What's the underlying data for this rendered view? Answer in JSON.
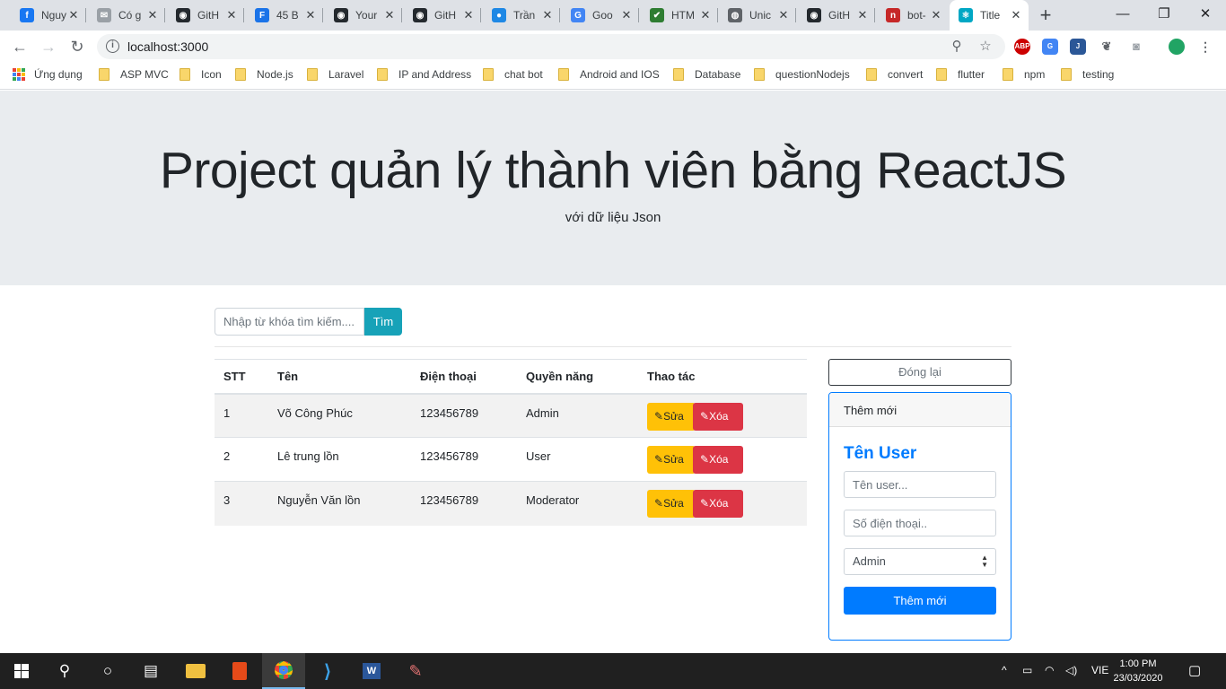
{
  "browser": {
    "tabs": [
      {
        "title": "Nguy",
        "icon": "facebook-icon",
        "color": "#1877f2",
        "glyph": "f"
      },
      {
        "title": "Có g",
        "icon": "mail-icon",
        "color": "#9aa0a6",
        "glyph": "✉"
      },
      {
        "title": "GitH",
        "icon": "github-icon",
        "color": "#24292e",
        "glyph": "◉"
      },
      {
        "title": "45 B",
        "icon": "feather-icon",
        "color": "#1a73e8",
        "glyph": "F"
      },
      {
        "title": "Your",
        "icon": "github-icon",
        "color": "#24292e",
        "glyph": "◉"
      },
      {
        "title": "GitH",
        "icon": "github-icon",
        "color": "#24292e",
        "glyph": "◉"
      },
      {
        "title": "Trần",
        "icon": "avatar-icon",
        "color": "#1e88e5",
        "glyph": "●"
      },
      {
        "title": "Goo",
        "icon": "google-translate-icon",
        "color": "#4285f4",
        "glyph": "G"
      },
      {
        "title": "HTM",
        "icon": "check-icon",
        "color": "#2e7d32",
        "glyph": "✔"
      },
      {
        "title": "Unic",
        "icon": "globe-icon",
        "color": "#5f6368",
        "glyph": "◍"
      },
      {
        "title": "GitH",
        "icon": "github-icon",
        "color": "#24292e",
        "glyph": "◉"
      },
      {
        "title": "bot-",
        "icon": "bot-icon",
        "color": "#c62828",
        "glyph": "n"
      },
      {
        "title": "Title",
        "icon": "react-icon",
        "color": "#00a7c4",
        "glyph": "⚛"
      }
    ],
    "url": "localhost:3000",
    "bookmarks": [
      "Ứng dụng",
      "ASP MVC",
      "Icon",
      "Node.js",
      "Laravel",
      "IP and Address",
      "chat bot",
      "Android and IOS",
      "Database",
      "questionNodejs",
      "convert",
      "flutter",
      "npm",
      "testing"
    ]
  },
  "page": {
    "title": "Project quản lý thành viên bằng ReactJS",
    "subtitle": "với dữ liệu Json",
    "search": {
      "placeholder": "Nhập từ khóa tìm kiếm....",
      "button": "Tìm"
    },
    "table": {
      "headers": [
        "STT",
        "Tên",
        "Điện thoại",
        "Quyền năng",
        "Thao tác"
      ],
      "rows": [
        {
          "stt": "1",
          "name": "Võ Công Phúc",
          "phone": "123456789",
          "role": "Admin"
        },
        {
          "stt": "2",
          "name": "Lê trung lồn",
          "phone": "123456789",
          "role": "User"
        },
        {
          "stt": "3",
          "name": "Nguyễn Văn lồn",
          "phone": "123456789",
          "role": "Moderator"
        }
      ],
      "edit_label": "Sửa",
      "delete_label": "Xóa"
    },
    "close_button": "Đóng lại",
    "form": {
      "header": "Thêm mới",
      "title": "Tên User",
      "name_placeholder": "Tên user...",
      "phone_placeholder": "Số điện thoại..",
      "role_value": "Admin",
      "submit": "Thêm mới"
    }
  },
  "taskbar": {
    "language": "VIE",
    "time": "1:00 PM",
    "date": "23/03/2020"
  },
  "colors": {
    "primary": "#007bff",
    "info": "#17a2b8",
    "warning": "#ffc107",
    "danger": "#dc3545",
    "jumbotron": "#e9ecef"
  }
}
